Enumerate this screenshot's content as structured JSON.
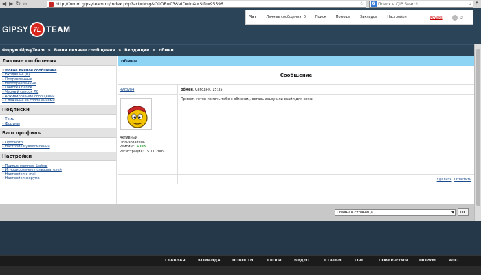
{
  "browser": {
    "url": "http://forum.gipsyteam.ru/index.php?act=Msg&CODE=03&VID=in&MSID=95596",
    "search_placeholder": "Поиск в QIP Search"
  },
  "header": {
    "logo_left": "GIPSY",
    "logo_badge": "7L",
    "logo_right": "TEAM",
    "top_links": [
      "Чат",
      "Личные сообщения: 0",
      "Поиск",
      "Помощь",
      "Закладки",
      "Настройки"
    ],
    "username": "Kovaks"
  },
  "breadcrumb": [
    "Форум GipsyTeam",
    "»",
    "Ваши личные сообщения",
    "»",
    "Входящие",
    "»",
    "обмен"
  ],
  "sidebar": {
    "sections": [
      {
        "title": "Личные сообщения",
        "items": [
          "Новое личное сообщение",
          "Входящие (0)",
          "Отправленные",
          "Неотправленные",
          "Очистка папок",
          "Черный список ЛС",
          "Архивирование сообщений",
          "Слежение за сообщениями"
        ]
      },
      {
        "title": "Подписки",
        "items": [
          "Темы",
          "Форумы"
        ]
      },
      {
        "title": "Ваш профиль",
        "items": [
          "Просмотр",
          "Настройки уведомлений"
        ]
      },
      {
        "title": "Настройки",
        "items": [
          "Прикрепленные файлы",
          "Игнорирование пользователей",
          "Настройки e-mail",
          "Настройки форума"
        ]
      }
    ]
  },
  "message": {
    "topic": "обмен",
    "section_title": "Сообщение",
    "author": "Ryzgy84",
    "header_title": "обмен",
    "header_date": ", Сегодня, 15:35",
    "body": "Привет, готов помочь тебе с обменом, оставь аську или скайп для связи",
    "author_status": "Активный",
    "author_group": "Пользователь",
    "rating_label": "Рейтинг: ",
    "rating_value": "+109",
    "registered": "Регистрация: 15.11.2009",
    "actions": [
      "Удалить",
      "Ответить"
    ]
  },
  "jump": {
    "selected": "Главная страница",
    "ok_label": "OK"
  },
  "footer_nav": [
    "ГЛАВНАЯ",
    "КОМАНДА",
    "НОВОСТИ",
    "БЛОГИ",
    "ВИДЕО",
    "СТАТЬИ",
    "LIVE",
    "ПОКЕР-РУМЫ",
    "ФОРУМ",
    "WIKI"
  ]
}
